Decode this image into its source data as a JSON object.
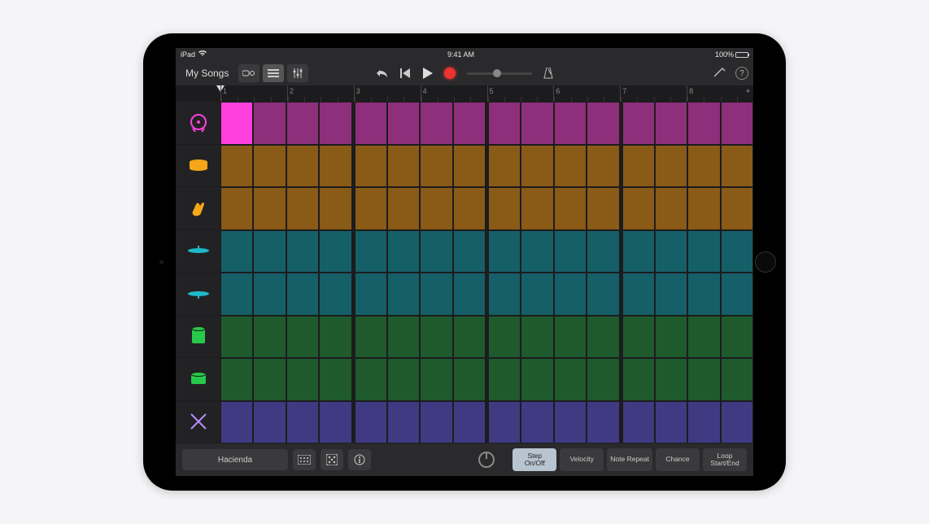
{
  "statusBar": {
    "device": "iPad",
    "time": "9:41 AM",
    "battery": "100%"
  },
  "toolbar": {
    "songs": "My Songs"
  },
  "ruler": {
    "bars": [
      "1",
      "2",
      "3",
      "4",
      "5",
      "6",
      "7",
      "8"
    ]
  },
  "tracks": [
    {
      "name": "kick",
      "color": "#8e2f7b",
      "activeColor": "#ff3fde",
      "activeSteps": [
        0
      ]
    },
    {
      "name": "snare",
      "color": "#8a5a17",
      "activeColor": "#ffb020",
      "activeSteps": []
    },
    {
      "name": "clap",
      "color": "#8a5a17",
      "activeColor": "#ffb020",
      "activeSteps": []
    },
    {
      "name": "hihat1",
      "color": "#155f68",
      "activeColor": "#1fb9c9",
      "activeSteps": []
    },
    {
      "name": "hihat2",
      "color": "#155f68",
      "activeColor": "#1fb9c9",
      "activeSteps": []
    },
    {
      "name": "tom1",
      "color": "#1f5a2d",
      "activeColor": "#27c94a",
      "activeSteps": []
    },
    {
      "name": "tom2",
      "color": "#1f5a2d",
      "activeColor": "#27c94a",
      "activeSteps": []
    },
    {
      "name": "sticks",
      "color": "#403a83",
      "activeColor": "#7a6fff",
      "activeSteps": []
    }
  ],
  "instrumentIcons": [
    {
      "name": "kick-icon",
      "color": "#ff3fde"
    },
    {
      "name": "snare-icon",
      "color": "#f7a61a"
    },
    {
      "name": "clap-icon",
      "color": "#f7a61a"
    },
    {
      "name": "cymbal1-icon",
      "color": "#1fb9c9"
    },
    {
      "name": "cymbal2-icon",
      "color": "#1fb9c9"
    },
    {
      "name": "tom1-icon",
      "color": "#27c94a"
    },
    {
      "name": "tom2-icon",
      "color": "#27c94a"
    },
    {
      "name": "sticks-icon",
      "color": "#b48cff"
    }
  ],
  "bottom": {
    "kit": "Hacienda",
    "modes": [
      {
        "label": "Step\nOn/Off",
        "active": true
      },
      {
        "label": "Velocity",
        "active": false
      },
      {
        "label": "Note Repeat",
        "active": false
      },
      {
        "label": "Chance",
        "active": false
      },
      {
        "label": "Loop\nStart/End",
        "active": false
      }
    ]
  },
  "grid": {
    "groups": 4,
    "stepsPerGroup": 4
  }
}
